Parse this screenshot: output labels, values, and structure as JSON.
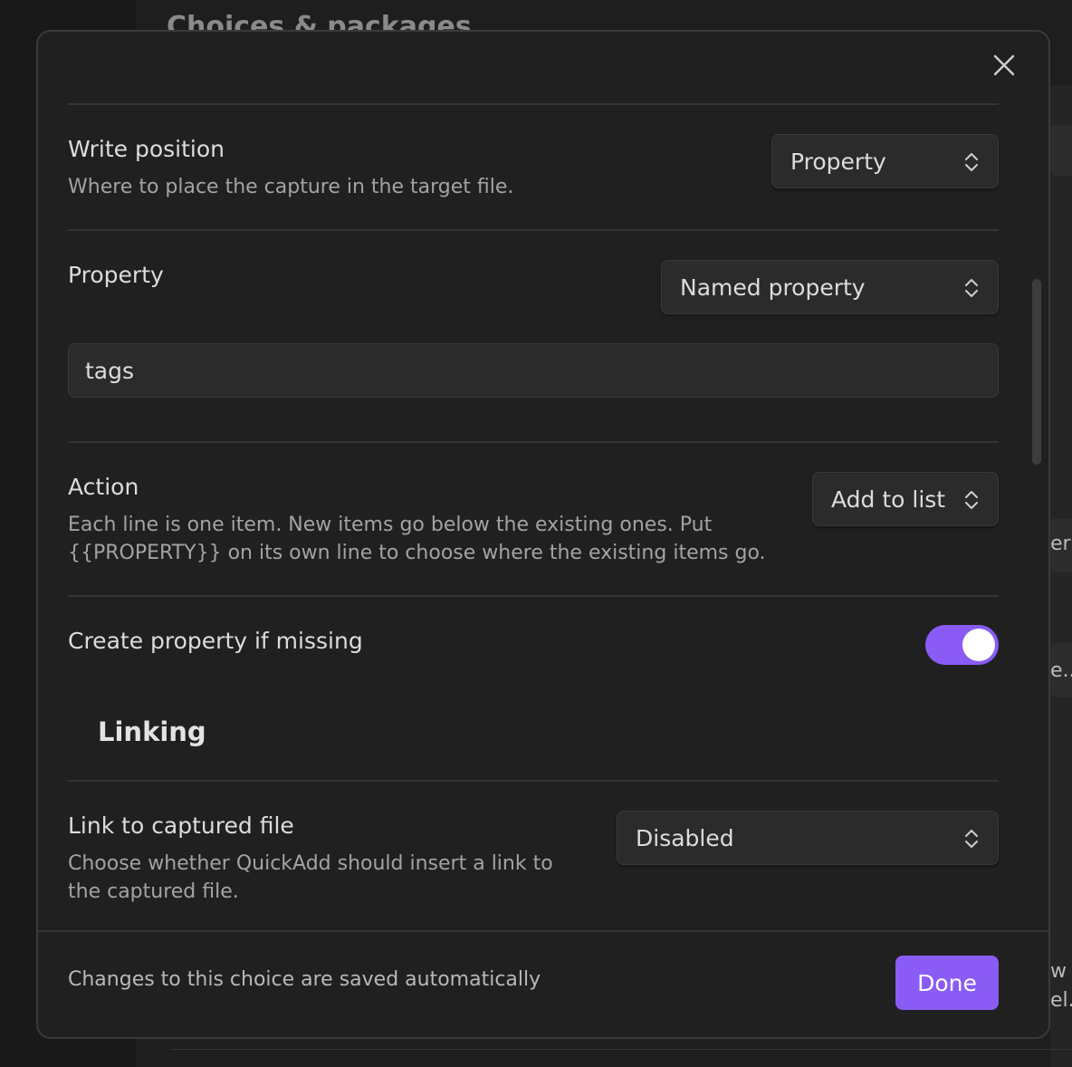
{
  "background": {
    "heading": "Choices & packages",
    "fragment_1": "er",
    "fragment_2": "e...",
    "fragment_3": "w t",
    "fragment_4": "el."
  },
  "modal": {
    "close_icon": "close-icon",
    "write_position": {
      "label": "Write position",
      "description": "Where to place the capture in the target file.",
      "selected": "Property"
    },
    "property": {
      "label": "Property",
      "selected": "Named property",
      "input_value": "tags"
    },
    "action": {
      "label": "Action",
      "description": "Each line is one item. New items go below the existing ones. Put {{PROPERTY}} on its own line to choose where the existing items go.",
      "selected": "Add to list"
    },
    "create_property": {
      "label": "Create property if missing",
      "enabled": true
    },
    "linking": {
      "heading": "Linking",
      "link_to_captured": {
        "label": "Link to captured file",
        "description": "Choose whether QuickAdd should insert a link to the captured file.",
        "selected": "Disabled"
      }
    },
    "footer": {
      "text": "Changes to this choice are saved automatically",
      "done_label": "Done"
    }
  },
  "colors": {
    "accent": "#8a5cf5",
    "modal_bg": "#202020",
    "control_bg": "#2b2b2b"
  }
}
